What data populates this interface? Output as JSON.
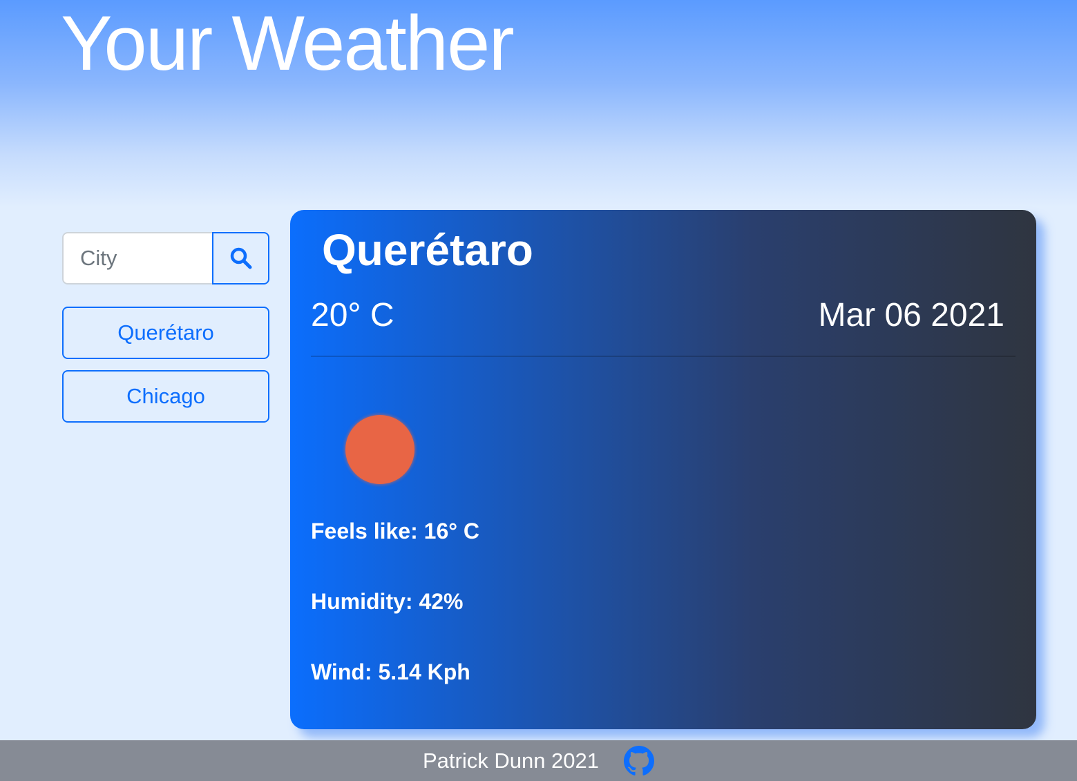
{
  "header": {
    "title": "Your Weather"
  },
  "search": {
    "placeholder": "City",
    "value": "",
    "icon": "search-icon"
  },
  "history": {
    "cities": [
      "Querétaro",
      "Chicago"
    ]
  },
  "weather": {
    "city": "Querétaro",
    "temperature": "20° C",
    "date": "Mar 06 2021",
    "icon": "sun-icon",
    "feels_like": "Feels like: 16° C",
    "humidity": "Humidity: 42%",
    "wind": "Wind: 5.14 Kph"
  },
  "footer": {
    "text": "Patrick Dunn 2021",
    "icon": "github-icon"
  },
  "colors": {
    "accent": "#0d6efd",
    "sun": "#e86545",
    "footer_bg": "#868b95"
  }
}
